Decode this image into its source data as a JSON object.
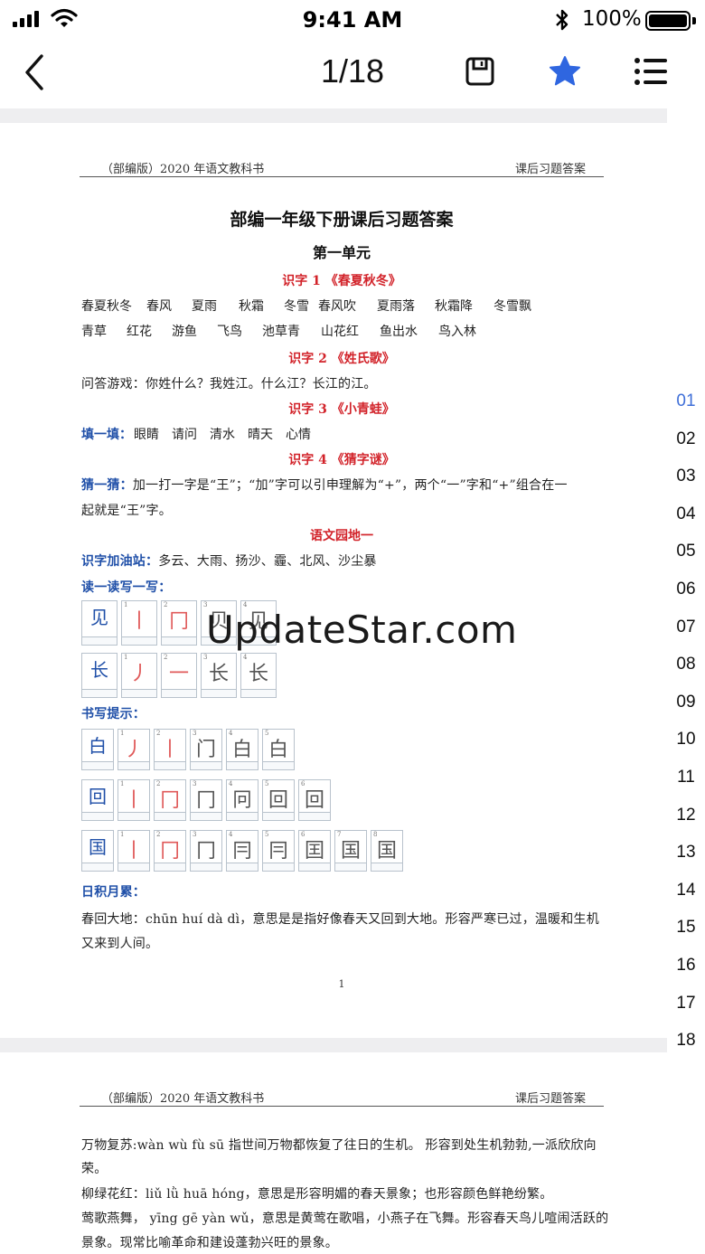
{
  "status_bar": {
    "time": "9:41 AM",
    "battery": "100%"
  },
  "nav": {
    "title": "1/18",
    "icons": [
      "back-chevron-icon",
      "save-disk-icon",
      "star-icon",
      "list-menu-icon"
    ],
    "accent_color": "#2f66e0"
  },
  "page1": {
    "header_left": "（部编版）2020 年语文教科书",
    "header_right": "课后习题答案",
    "title": "部编一年级下册课后习题答案",
    "unit": "第一单元",
    "s1_title": "识字 1 《春夏秋冬》",
    "s1_row1": [
      "春夏秋冬",
      "春风",
      "夏雨",
      "秋霜",
      "冬雪",
      "春风吹",
      "夏雨落",
      "秋霜降",
      "冬雪飘"
    ],
    "s1_row2": [
      "青草",
      "红花",
      "游鱼",
      "飞鸟",
      "池草青",
      "山花红",
      "鱼出水",
      "鸟入林"
    ],
    "s2_title": "识字 2 《姓氏歌》",
    "s2_text": "问答游戏：你姓什么？我姓江。什么江？长江的江。",
    "s3_title": "识字 3 《小青蛙》",
    "s3_label": "填一填：",
    "s3_words": [
      "眼睛",
      "请问",
      "清水",
      "晴天",
      "心情"
    ],
    "s4_title": "识字 4 《猜字谜》",
    "s4_label": "猜一猜：",
    "s4_line1": "加一打一字是“王”；“加”字可以引申理解为“+”，两个“一”字和“+”组合在一",
    "s4_line2": "起就是“王”字。",
    "garden_title": "语文园地一",
    "garden_label": "识字加油站：",
    "garden_text": "多云、大雨、扬沙、霾、北风、沙尘暴",
    "read_write_label": "读一读写一写：",
    "grid_jian": [
      "见",
      "丨",
      "冂",
      "贝",
      "见"
    ],
    "grid_chang": [
      "长",
      "丿",
      "一",
      "长",
      "长"
    ],
    "writing_tips_label": "书写提示：",
    "grid_bai": [
      "白",
      "丿",
      "丨",
      "门",
      "白",
      "白"
    ],
    "grid_hui": [
      "回",
      "丨",
      "冂",
      "冂",
      "冋",
      "回",
      "回"
    ],
    "grid_guo": [
      "国",
      "丨",
      "冂",
      "冂",
      "冃",
      "冃",
      "囯",
      "国",
      "国"
    ],
    "daily_label": "日积月累：",
    "daily_line1": "春回大地：chūn huí dà dì，意思是是指好像春天又回到大地。形容严寒已过，温暖和生机",
    "daily_line2": "又来到人间。",
    "page_number": "1"
  },
  "page2": {
    "header_left": "（部编版）2020 年语文教科书",
    "header_right": "课后习题答案",
    "line1": "万物复苏:wàn wù fù sū 指世间万物都恢复了往日的生机。 形容到处生机勃勃,一派欣欣向",
    "line2": "荣。",
    "line3": "柳绿花红：liǔ lǜ huā hóng，意思是形容明媚的春天景象；也形容颜色鲜艳纷繁。",
    "line4": "莺歌燕舞，  yīng gē yàn wǔ，意思是黄莺在歌唱，小燕子在飞舞。形容春天鸟儿喧闹活跃的",
    "line5": "景象。现常比喻革命和建设蓬勃兴旺的景象。"
  },
  "watermark": "UpdateStar.com",
  "page_index": [
    "01",
    "02",
    "03",
    "04",
    "05",
    "06",
    "07",
    "08",
    "09",
    "10",
    "11",
    "12",
    "13",
    "14",
    "15",
    "16",
    "17",
    "18"
  ]
}
